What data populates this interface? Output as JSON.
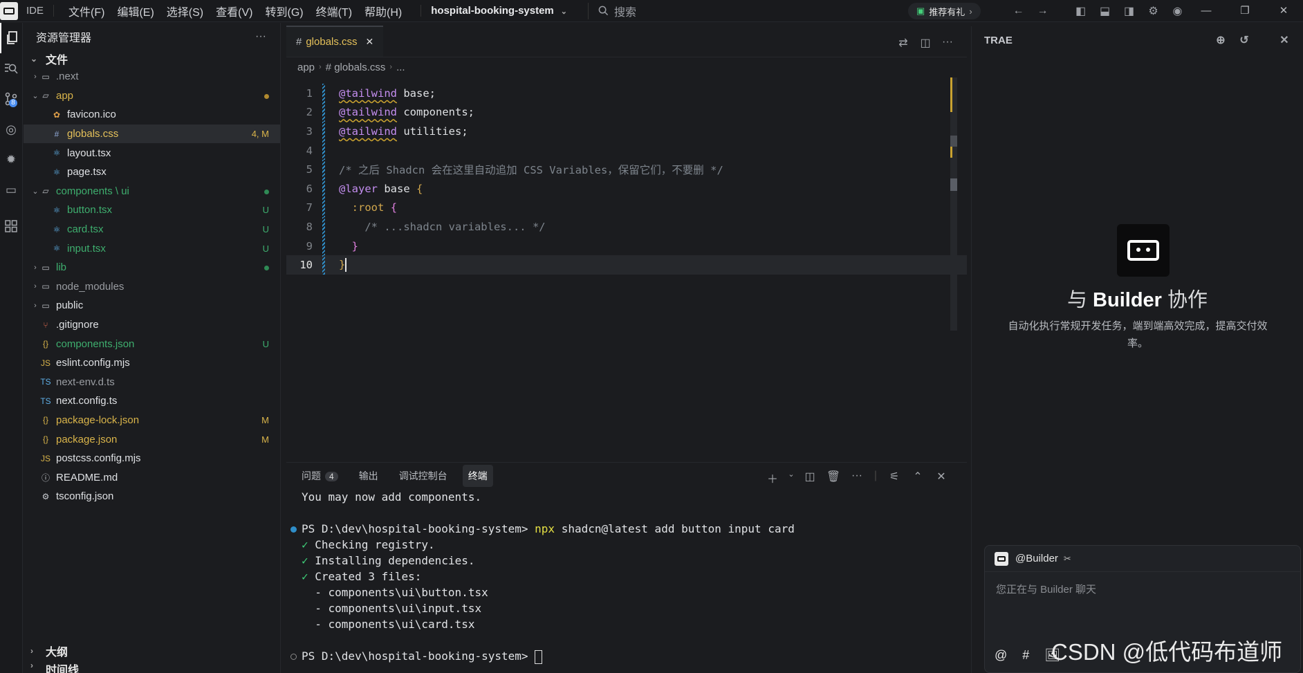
{
  "titlebar": {
    "ide_label": "IDE",
    "menu": [
      "文件(F)",
      "编辑(E)",
      "选择(S)",
      "查看(V)",
      "转到(G)",
      "终端(T)",
      "帮助(H)"
    ],
    "project": "hospital-booking-system",
    "search_placeholder": "搜索",
    "promo": "推荐有礼"
  },
  "activity_bar": {
    "scm_badge": "8"
  },
  "explorer": {
    "title": "资源管理器",
    "more": "···",
    "section_files": "文件",
    "section_outline": "大纲",
    "section_timeline": "时间线",
    "items": [
      {
        "label": ".next",
        "color": "#9a9da2",
        "chev": "›",
        "icon": "folder",
        "status": ""
      },
      {
        "label": "app",
        "color": "#d9b44a",
        "chev": "⌄",
        "icon": "folder-open",
        "status": "dot",
        "status_color": "#b0892f"
      },
      {
        "label": "favicon.ico",
        "color": "#dfe1e4",
        "chev": "",
        "icon": "favicon",
        "status": ""
      },
      {
        "label": "globals.css",
        "color": "#e5c15a",
        "chev": "",
        "icon": "hash",
        "status": "4, M",
        "status_color": "#d9b44a"
      },
      {
        "label": "layout.tsx",
        "color": "#dfe1e4",
        "chev": "",
        "icon": "react",
        "status": ""
      },
      {
        "label": "page.tsx",
        "color": "#dfe1e4",
        "chev": "",
        "icon": "react",
        "status": ""
      },
      {
        "label": "components \\ ui",
        "color": "#3eae6e",
        "chev": "⌄",
        "icon": "folder-open",
        "status": "dot",
        "status_color": "#2f8a55"
      },
      {
        "label": "button.tsx",
        "color": "#3eae6e",
        "chev": "",
        "icon": "react",
        "status": "U",
        "status_color": "#3eae6e"
      },
      {
        "label": "card.tsx",
        "color": "#3eae6e",
        "chev": "",
        "icon": "react",
        "status": "U",
        "status_color": "#3eae6e"
      },
      {
        "label": "input.tsx",
        "color": "#3eae6e",
        "chev": "",
        "icon": "react",
        "status": "U",
        "status_color": "#3eae6e"
      },
      {
        "label": "lib",
        "color": "#3eae6e",
        "chev": "›",
        "icon": "folder",
        "status": "dot",
        "status_color": "#2f8a55"
      },
      {
        "label": "node_modules",
        "color": "#9a9da2",
        "chev": "›",
        "icon": "folder",
        "status": ""
      },
      {
        "label": "public",
        "color": "#dfe1e4",
        "chev": "›",
        "icon": "folder",
        "status": ""
      },
      {
        "label": ".gitignore",
        "color": "#dfe1e4",
        "chev": "",
        "icon": "git",
        "status": ""
      },
      {
        "label": "components.json",
        "color": "#3eae6e",
        "chev": "",
        "icon": "json",
        "status": "U",
        "status_color": "#3eae6e"
      },
      {
        "label": "eslint.config.mjs",
        "color": "#dfe1e4",
        "chev": "",
        "icon": "js",
        "status": ""
      },
      {
        "label": "next-env.d.ts",
        "color": "#9a9da2",
        "chev": "",
        "icon": "ts",
        "status": ""
      },
      {
        "label": "next.config.ts",
        "color": "#dfe1e4",
        "chev": "",
        "icon": "ts",
        "status": ""
      },
      {
        "label": "package-lock.json",
        "color": "#d9b44a",
        "chev": "",
        "icon": "json",
        "status": "M",
        "status_color": "#d9b44a"
      },
      {
        "label": "package.json",
        "color": "#d9b44a",
        "chev": "",
        "icon": "json",
        "status": "M",
        "status_color": "#d9b44a"
      },
      {
        "label": "postcss.config.mjs",
        "color": "#dfe1e4",
        "chev": "",
        "icon": "js",
        "status": ""
      },
      {
        "label": "README.md",
        "color": "#dfe1e4",
        "chev": "",
        "icon": "info",
        "status": ""
      },
      {
        "label": "tsconfig.json",
        "color": "#dfe1e4",
        "chev": "",
        "icon": "gear",
        "status": ""
      }
    ]
  },
  "editor": {
    "tab": "globals.css",
    "breadcrumb": [
      "app",
      "# globals.css",
      "..."
    ],
    "current_line": 10,
    "lines": [
      {
        "n": "1",
        "parts": [
          [
            "kw",
            "@tailwind"
          ],
          [
            "pl",
            " base;"
          ]
        ]
      },
      {
        "n": "2",
        "parts": [
          [
            "kw",
            "@tailwind"
          ],
          [
            "pl",
            " components;"
          ]
        ]
      },
      {
        "n": "3",
        "parts": [
          [
            "kw",
            "@tailwind"
          ],
          [
            "pl",
            " utilities;"
          ]
        ]
      },
      {
        "n": "4",
        "parts": []
      },
      {
        "n": "5",
        "parts": [
          [
            "cm",
            "/* 之后 Shadcn 会在这里自动追加 CSS Variables，保留它们，不要删 */"
          ]
        ]
      },
      {
        "n": "6",
        "parts": [
          [
            "kw2",
            "@layer"
          ],
          [
            "pl",
            " base "
          ],
          [
            "sel2",
            "{"
          ]
        ]
      },
      {
        "n": "7",
        "parts": [
          [
            "pl",
            "  "
          ],
          [
            "sel2",
            ":root"
          ],
          [
            "pl",
            " "
          ],
          [
            "br",
            "{"
          ]
        ]
      },
      {
        "n": "8",
        "parts": [
          [
            "pl",
            "    "
          ],
          [
            "cm",
            "/* ...shadcn variables... */"
          ]
        ]
      },
      {
        "n": "9",
        "parts": [
          [
            "pl",
            "  "
          ],
          [
            "br",
            "}"
          ]
        ]
      },
      {
        "n": "10",
        "parts": [
          [
            "sel2",
            "}"
          ]
        ]
      }
    ]
  },
  "panel": {
    "tabs": [
      "问题",
      "输出",
      "调试控制台",
      "终端"
    ],
    "problems_count": "4",
    "active_tab": "终端",
    "terminal": {
      "line1": "You may now add components.",
      "prompt": "PS D:\\dev\\hospital-booking-system> ",
      "cmd_npx": "npx",
      "cmd_rest": " shadcn@latest add button input card",
      "check1": "Checking registry.",
      "check2": "Installing dependencies.",
      "check3": "Created 3 files:",
      "file1": "  - components\\ui\\button.tsx",
      "file2": "  - components\\ui\\input.tsx",
      "file3": "  - components\\ui\\card.tsx",
      "prompt2": "PS D:\\dev\\hospital-booking-system> "
    }
  },
  "right_panel": {
    "title": "TRAE",
    "heading_pre": "与 ",
    "heading_bold": "Builder",
    "heading_post": " 协作",
    "desc": "自动化执行常规开发任务，端到端高效完成，提高交付效率。",
    "chat_tag": "@Builder",
    "chat_placeholder": "您正在与 Builder 聊天",
    "chat_tools": [
      "@",
      "#",
      "🖼"
    ]
  },
  "watermark": "CSDN @低代码布道师",
  "colors": {
    "accent": "#2f8ec9",
    "modified": "#d9b44a",
    "untracked": "#3eae6e"
  }
}
